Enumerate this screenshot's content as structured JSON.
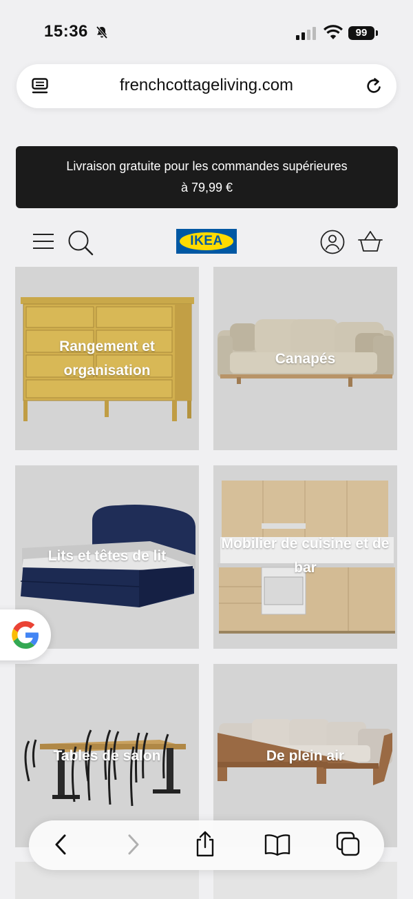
{
  "status_bar": {
    "time": "15:36",
    "battery": "99"
  },
  "browser": {
    "url": "frenchcottageliving.com"
  },
  "promo": {
    "line1": "Livraison gratuite pour les commandes supérieures",
    "line2": "à 79,99 €"
  },
  "header": {
    "logo_text": "IKEA"
  },
  "categories": [
    {
      "label_line1": "Rangement et",
      "label_line2": "organisation"
    },
    {
      "label_line1": "Canapés",
      "label_line2": ""
    },
    {
      "label_line1": "Lits et têtes de lit",
      "label_line2": ""
    },
    {
      "label_line1": "Mobilier de cuisine et de",
      "label_line2": "bar"
    },
    {
      "label_line1": "Tables de salon",
      "label_line2": ""
    },
    {
      "label_line1": "De plein air",
      "label_line2": ""
    }
  ],
  "colors": {
    "brand_blue": "#0058a3",
    "brand_yellow": "#ffdb00",
    "promo_bg": "#1b1b1b"
  }
}
